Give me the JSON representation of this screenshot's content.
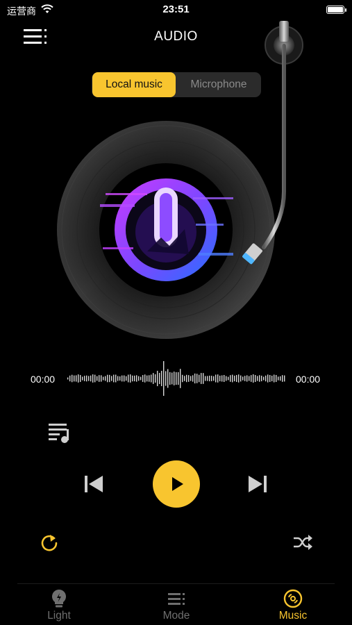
{
  "status_bar": {
    "carrier": "运营商",
    "time": "23:51"
  },
  "header": {
    "title": "AUDIO"
  },
  "source_tabs": [
    {
      "label": "Local music",
      "selected": true
    },
    {
      "label": "Microphone",
      "selected": false
    }
  ],
  "player": {
    "current_time": "00:00",
    "total_time": "00:00",
    "state": "paused"
  },
  "tabbar": [
    {
      "label": "Light",
      "icon": "bulb-icon",
      "active": false
    },
    {
      "label": "Mode",
      "icon": "list-icon",
      "active": false
    },
    {
      "label": "Music",
      "icon": "vinyl-disc-icon",
      "active": true
    }
  ],
  "colors": {
    "accent": "#f8c52f",
    "inactive": "#6f6f6f",
    "background": "#000000"
  }
}
